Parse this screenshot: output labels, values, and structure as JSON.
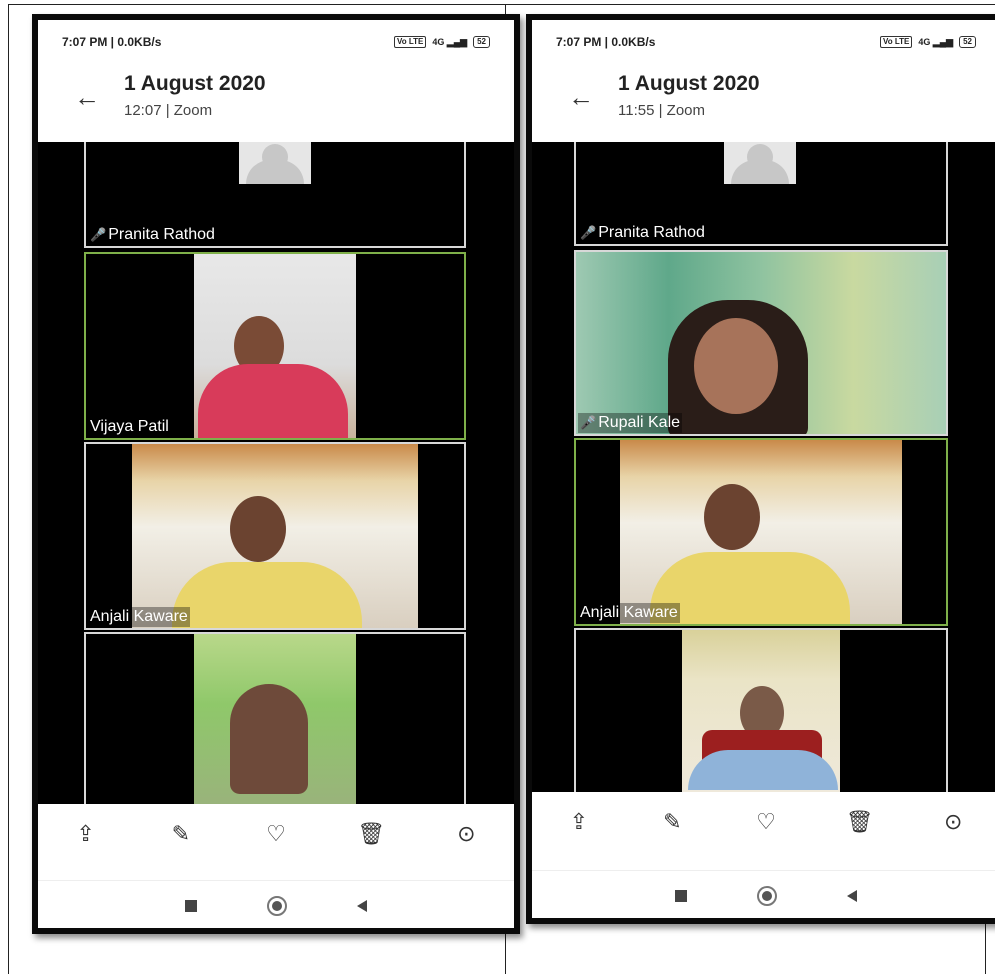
{
  "screens": [
    {
      "status": {
        "time": "7:07 PM | 0.0KB/s",
        "volte": "Vo LTE",
        "net": "4G",
        "battery": "52"
      },
      "header": {
        "title": "1 August 2020",
        "subtitle": "12:07 | Zoom"
      },
      "participants": [
        {
          "name": "Pranita Rathod",
          "muted": true
        },
        {
          "name": "Vijaya Patil",
          "muted": false
        },
        {
          "name": "Anjali Kaware",
          "muted": false
        },
        {
          "name": "",
          "muted": false
        }
      ]
    },
    {
      "status": {
        "time": "7:07 PM | 0.0KB/s",
        "volte": "Vo LTE",
        "net": "4G",
        "battery": "52"
      },
      "header": {
        "title": "1 August 2020",
        "subtitle": "11:55 | Zoom"
      },
      "participants": [
        {
          "name": "Pranita Rathod",
          "muted": true
        },
        {
          "name": "Rupali Kale",
          "muted": true
        },
        {
          "name": "Anjali Kaware",
          "muted": false
        },
        {
          "name": "",
          "muted": false
        }
      ]
    }
  ],
  "icons": {
    "back": "arrow-left",
    "share": "share-icon",
    "edit": "edit-icon",
    "favorite": "heart-icon",
    "delete": "trash-icon",
    "more": "more-icon",
    "mute": "mic-off-icon"
  },
  "colors": {
    "active_border": "#7fb04a",
    "tile_border": "#d8d8d8",
    "background": "#000000"
  }
}
